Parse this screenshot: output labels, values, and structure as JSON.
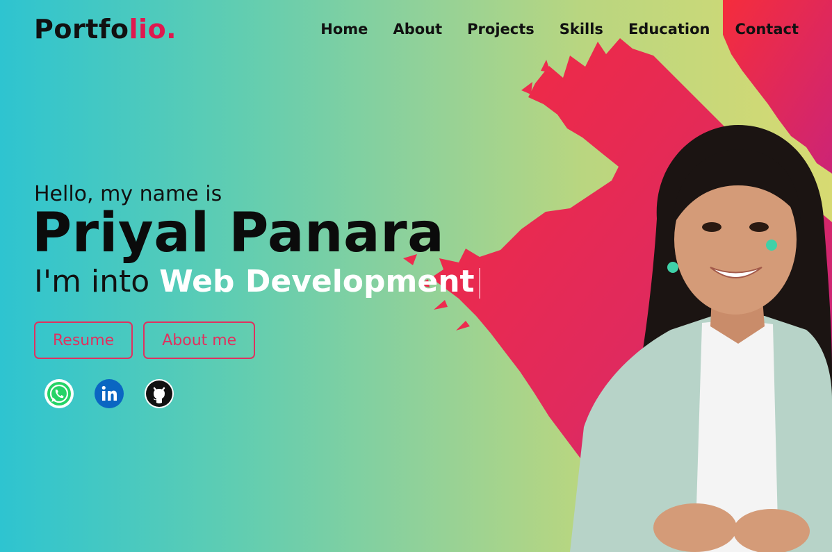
{
  "brand": {
    "text_main": "Portfo",
    "text_accent": "lio."
  },
  "nav": {
    "items": [
      {
        "label": "Home"
      },
      {
        "label": "About"
      },
      {
        "label": "Projects"
      },
      {
        "label": "Skills"
      },
      {
        "label": "Education"
      },
      {
        "label": "Contact"
      }
    ]
  },
  "hero": {
    "greeting": "Hello, my name is",
    "name": "Priyal Panara",
    "tagline_prefix": "I'm into ",
    "tagline_highlight": "Web Development"
  },
  "buttons": {
    "resume": "Resume",
    "about_me": "About me"
  },
  "socials": [
    {
      "icon": "whatsapp-icon",
      "color": "#25D366"
    },
    {
      "icon": "linkedin-icon",
      "color": "#0A66C2"
    },
    {
      "icon": "github-icon",
      "color": "#111111"
    }
  ],
  "colors": {
    "accent": "#e0184f",
    "button_outline": "#e0315f",
    "brush_red": "#ee2b4e",
    "brush_magenta": "#c3207f",
    "gradient_left": "#2ec4d0",
    "gradient_right": "#d7da72"
  }
}
